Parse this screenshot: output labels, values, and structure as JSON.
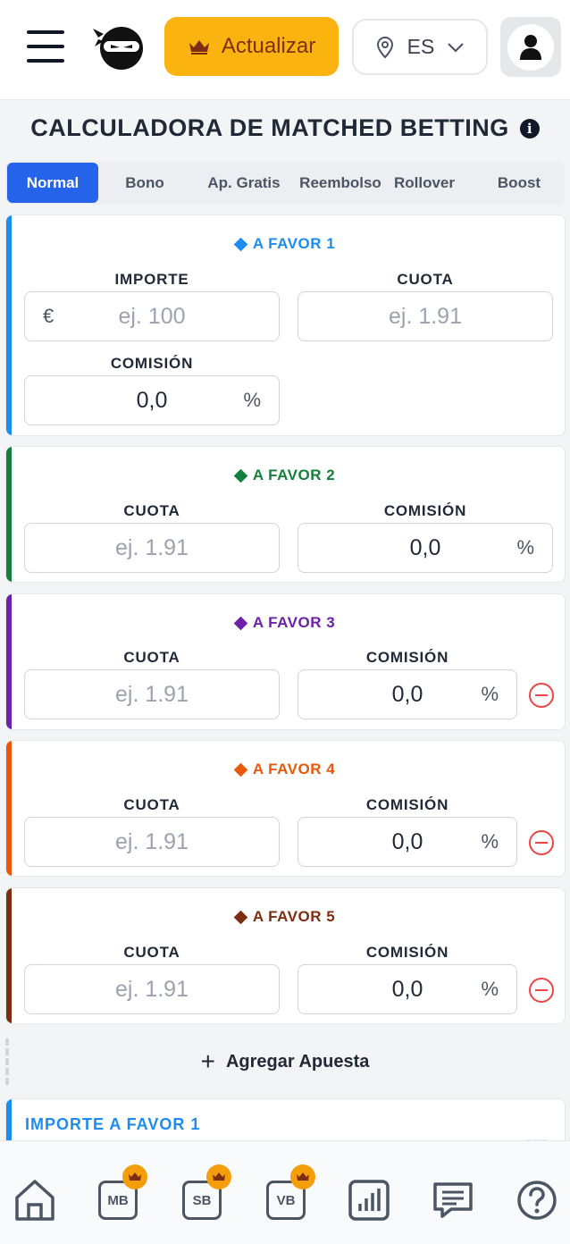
{
  "header": {
    "upgrade_label": "Actualizar",
    "language": "ES"
  },
  "title": "CALCULADORA DE MATCHED BETTING",
  "tabs": [
    {
      "label": "Normal",
      "active": true
    },
    {
      "label": "Bono"
    },
    {
      "label": "Ap. Gratis"
    },
    {
      "label": "Reembolso"
    },
    {
      "label": "Rollover"
    },
    {
      "label": "Boost"
    }
  ],
  "bets": [
    {
      "title": "A FAVOR 1",
      "color": "#1d8cf0",
      "importe_label": "IMPORTE",
      "importe_placeholder": "ej. 100",
      "currency": "€",
      "cuota_label": "CUOTA",
      "cuota_placeholder": "ej. 1.91",
      "comision_label": "COMISIÓN",
      "comision_value": "0,0",
      "unit": "%"
    },
    {
      "title": "A FAVOR 2",
      "color": "#15803d",
      "cuota_label": "CUOTA",
      "cuota_placeholder": "ej. 1.91",
      "comision_label": "COMISIÓN",
      "comision_value": "0,0",
      "unit": "%"
    },
    {
      "title": "A FAVOR 3",
      "color": "#6b21a8",
      "cuota_label": "CUOTA",
      "cuota_placeholder": "ej. 1.91",
      "comision_label": "COMISIÓN",
      "comision_value": "0,0",
      "unit": "%"
    },
    {
      "title": "A FAVOR 4",
      "color": "#ea580c",
      "cuota_label": "CUOTA",
      "cuota_placeholder": "ej. 1.91",
      "comision_label": "COMISIÓN",
      "comision_value": "0,0",
      "unit": "%"
    },
    {
      "title": "A FAVOR 5",
      "color": "#7c2d12",
      "cuota_label": "CUOTA",
      "cuota_placeholder": "ej. 1.91",
      "comision_label": "COMISIÓN",
      "comision_value": "0,0",
      "unit": "%"
    }
  ],
  "add_bet_label": "Agregar Apuesta",
  "result": {
    "label": "IMPORTE A FAVOR 1",
    "value": "---"
  },
  "bottom_nav": [
    {
      "icon": "home-icon"
    },
    {
      "label": "MB",
      "premium": true
    },
    {
      "label": "SB",
      "premium": true
    },
    {
      "label": "VB",
      "premium": true
    },
    {
      "icon": "chart-icon"
    },
    {
      "icon": "chat-icon"
    },
    {
      "icon": "help-icon"
    }
  ]
}
